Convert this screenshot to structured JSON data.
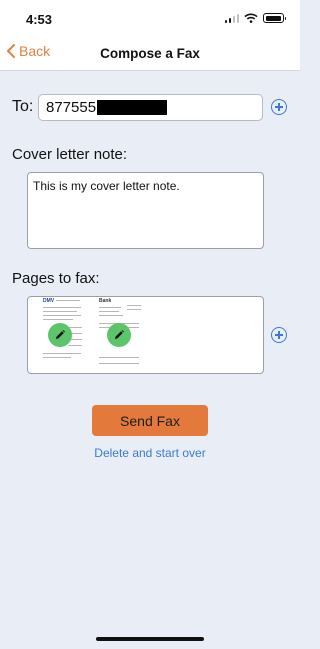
{
  "status_bar": {
    "time": "4:53"
  },
  "nav": {
    "back_label": "Back",
    "title": "Compose a Fax"
  },
  "to": {
    "label": "To:",
    "value_visible": "877555",
    "value_redacted": true
  },
  "cover_letter": {
    "label": "Cover letter note:",
    "value": "This is my cover letter note."
  },
  "pages": {
    "label": "Pages to fax:",
    "thumbnails": [
      {
        "name": "page-1",
        "header_text": "DMV"
      },
      {
        "name": "page-2",
        "header_text": "Bank"
      }
    ]
  },
  "actions": {
    "send_label": "Send Fax",
    "delete_label": "Delete and start over"
  },
  "colors": {
    "accent_orange": "#e37a3c",
    "link_blue": "#3a7bd5",
    "edit_green": "#5cc46a",
    "background": "#e9eef6"
  },
  "icons": [
    "back-chevron-icon",
    "add-icon",
    "pencil-icon",
    "wifi-icon",
    "battery-icon",
    "signal-icon"
  ]
}
